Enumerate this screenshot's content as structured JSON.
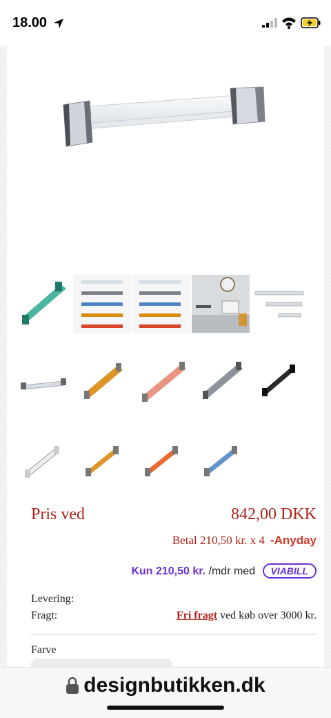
{
  "status_bar": {
    "time": "18.00"
  },
  "product": {
    "price_label": "Pris ved",
    "price_value": "842,00  DKK",
    "anyday_text": "Betal 210,50 kr. x 4",
    "anyday_brand": "-Anyday",
    "viabill_kun": "Kun 210,50 kr.",
    "viabill_suffix": "/mdr med",
    "viabill_brand": "VIABILL",
    "levering_label": "Levering:",
    "fragt_label": "Fragt:",
    "fri_fragt_link": "Fri fragt",
    "fragt_suffix": "ved køb over 3000 kr.",
    "farve_label": "Farve"
  },
  "thumbnails": {
    "colors": {
      "teal": "#2aa98f",
      "clear": "#d6dde3",
      "amber": "#d98a12",
      "salmon": "#e78a74",
      "smoke": "#7a7f8a",
      "black": "#2a2a2a",
      "white": "#e8e8e8",
      "orange": "#e45b1a",
      "blue": "#4f86c6"
    }
  },
  "browser": {
    "domain": "designbutikken.dk"
  }
}
